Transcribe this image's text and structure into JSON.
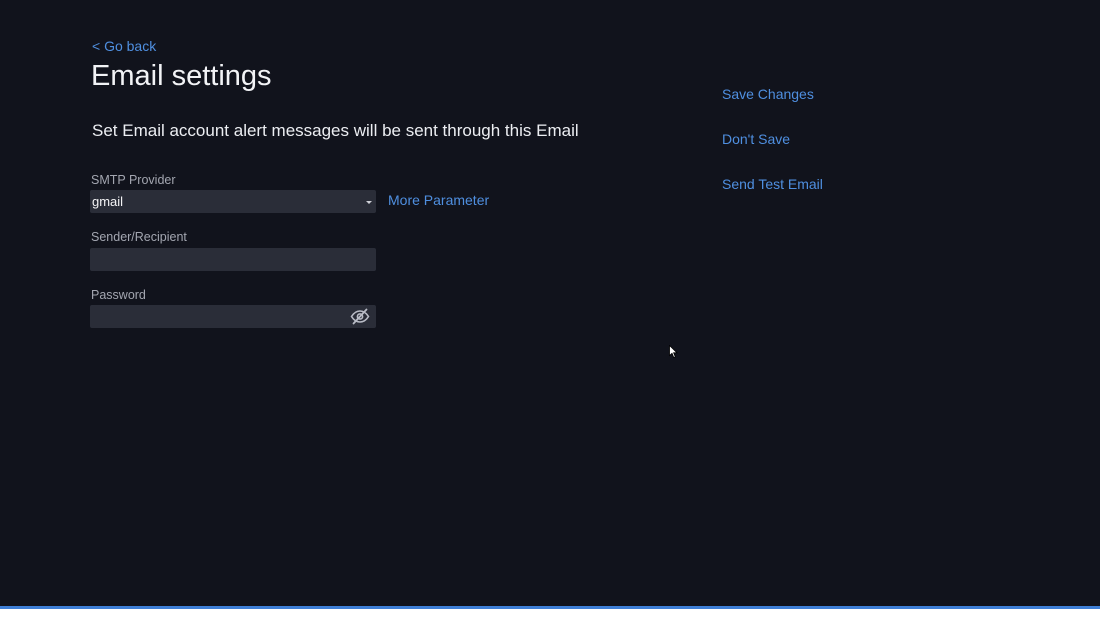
{
  "nav": {
    "go_back": "< Go back"
  },
  "header": {
    "title": "Email settings",
    "subtitle": "Set Email account alert messages will be sent through this Email"
  },
  "form": {
    "smtp_provider": {
      "label": "SMTP Provider",
      "value": "gmail"
    },
    "more_parameter": "More Parameter",
    "sender_recipient": {
      "label": "Sender/Recipient",
      "value": ""
    },
    "password": {
      "label": "Password",
      "value": "",
      "toggle_icon": "eye-slash-icon"
    }
  },
  "actions": {
    "save_changes": "Save Changes",
    "dont_save": "Don't Save",
    "send_test_email": "Send Test Email"
  },
  "colors": {
    "background": "#11131c",
    "field": "#2a2d38",
    "link": "#4f8fe0",
    "bottom_bar": "#3f7fd6"
  }
}
